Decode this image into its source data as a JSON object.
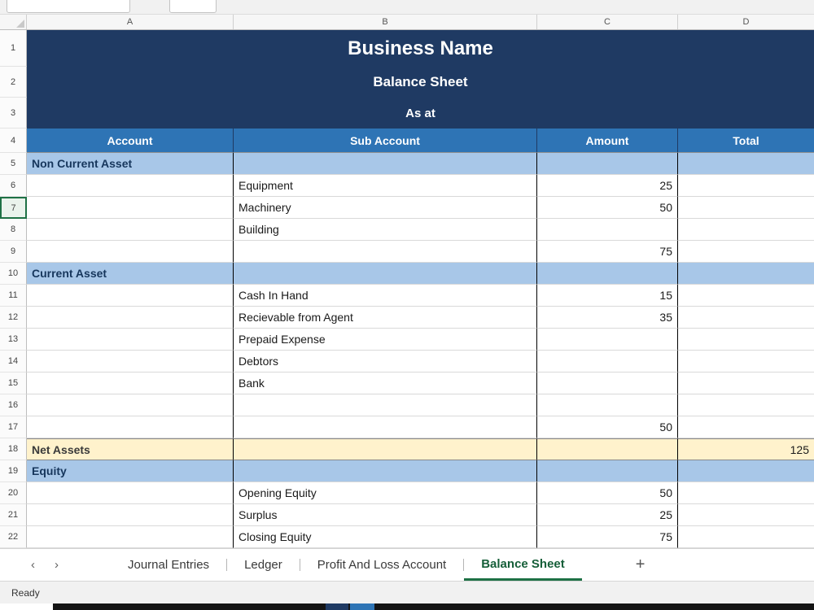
{
  "grid": {
    "column_letters": [
      "A",
      "B",
      "C",
      "D"
    ],
    "selected_row": "7",
    "title_rows": [
      {
        "n": "1",
        "text": "Business Name"
      },
      {
        "n": "2",
        "text": "Balance Sheet"
      },
      {
        "n": "3",
        "text": "As at"
      }
    ],
    "header_row": {
      "n": "4",
      "cells": [
        "Account",
        "Sub Account",
        "Amount",
        "Total"
      ]
    },
    "rows": [
      {
        "n": "5",
        "a": "Non Current Asset",
        "b": "",
        "c": "",
        "d": "",
        "style": "section"
      },
      {
        "n": "6",
        "a": "",
        "b": "Equipment",
        "c": "25",
        "d": "",
        "style": ""
      },
      {
        "n": "7",
        "a": "",
        "b": "Machinery",
        "c": "50",
        "d": "",
        "style": ""
      },
      {
        "n": "8",
        "a": "",
        "b": "Building",
        "c": "",
        "d": "",
        "style": ""
      },
      {
        "n": "9",
        "a": "",
        "b": "",
        "c": "75",
        "d": "",
        "style": ""
      },
      {
        "n": "10",
        "a": "Current Asset",
        "b": "",
        "c": "",
        "d": "",
        "style": "section"
      },
      {
        "n": "11",
        "a": "",
        "b": "Cash In Hand",
        "c": "15",
        "d": "",
        "style": ""
      },
      {
        "n": "12",
        "a": "",
        "b": "Recievable from Agent",
        "c": "35",
        "d": "",
        "style": ""
      },
      {
        "n": "13",
        "a": "",
        "b": "Prepaid Expense",
        "c": "",
        "d": "",
        "style": ""
      },
      {
        "n": "14",
        "a": "",
        "b": "Debtors",
        "c": "",
        "d": "",
        "style": ""
      },
      {
        "n": "15",
        "a": "",
        "b": "Bank",
        "c": "",
        "d": "",
        "style": ""
      },
      {
        "n": "16",
        "a": "",
        "b": "",
        "c": "",
        "d": "",
        "style": ""
      },
      {
        "n": "17",
        "a": "",
        "b": "",
        "c": "50",
        "d": "",
        "style": ""
      },
      {
        "n": "18",
        "a": "Net Assets",
        "b": "",
        "c": "",
        "d": "125",
        "style": "total"
      },
      {
        "n": "19",
        "a": "Equity",
        "b": "",
        "c": "",
        "d": "",
        "style": "section"
      },
      {
        "n": "20",
        "a": "",
        "b": "Opening Equity",
        "c": "50",
        "d": "",
        "style": ""
      },
      {
        "n": "21",
        "a": "",
        "b": "Surplus",
        "c": "25",
        "d": "",
        "style": ""
      },
      {
        "n": "22",
        "a": "",
        "b": "Closing Equity",
        "c": "75",
        "d": "",
        "style": ""
      }
    ]
  },
  "sheet_tabs": {
    "nav_prev": "‹",
    "nav_next": "›",
    "tabs": [
      "Journal Entries",
      "Ledger",
      "Profit And Loss Account",
      "Balance Sheet"
    ],
    "active": "Balance Sheet",
    "add_label": "+"
  },
  "status_bar": {
    "text": "Ready"
  },
  "colors": {
    "title_navy": "#1f3a63",
    "header_blue": "#2e74b5",
    "band_blue": "#a8c7e8",
    "band_yellow": "#fff2cc",
    "active_tab_green": "#1e7145"
  }
}
